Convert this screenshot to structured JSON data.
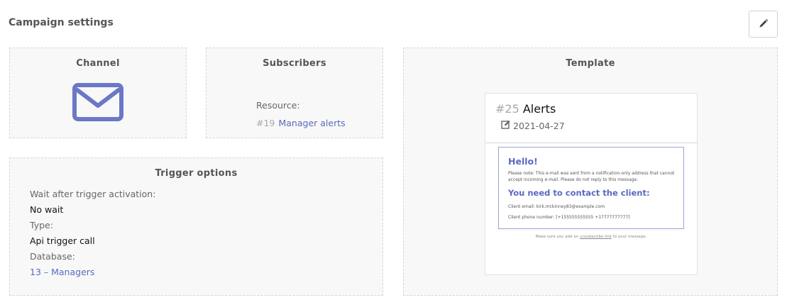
{
  "header": {
    "title": "Campaign settings"
  },
  "icons": {
    "edit": "pencil-icon",
    "channel": "envelope-icon",
    "date": "edit-note-icon"
  },
  "colors": {
    "accent": "#5a6ac0",
    "envelope": "#6b78c6"
  },
  "channel": {
    "title": "Channel"
  },
  "subscribers": {
    "title": "Subscribers",
    "resource_label": "Resource:",
    "resource_id": "#19",
    "resource_name": "Manager alerts"
  },
  "trigger": {
    "title": "Trigger options",
    "wait_label": "Wait after trigger activation:",
    "wait_value": "No wait",
    "type_label": "Type:",
    "type_value": "Api trigger call",
    "database_label": "Database:",
    "database_value": "13 – Managers"
  },
  "template": {
    "title": "Template",
    "id": "#25",
    "name": "Alerts",
    "date": "2021-04-27",
    "preview": {
      "greeting": "Hello!",
      "note": "Please note: This e-mail was sent from a notification-only address that cannot accept incoming e-mail. Please do not reply to this message.",
      "heading": "You need to contact the client:",
      "email_line": "Client email: kirk.mckinney83@example.com",
      "phone_line": "Client phone number: [+155555555555 +17777777777]",
      "footer_before": "Make sure you add an",
      "footer_link": "unsubscribe link",
      "footer_after": "to your message."
    }
  }
}
